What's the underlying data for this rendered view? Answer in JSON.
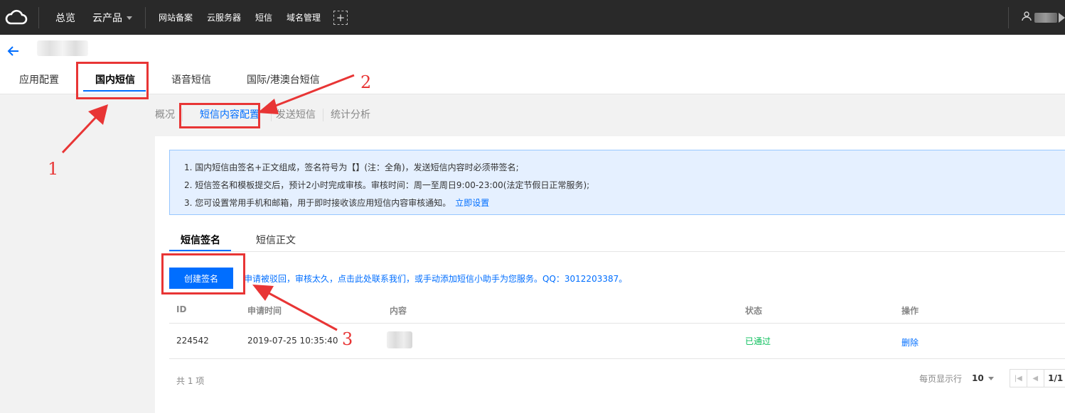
{
  "topnav": {
    "overview": "总览",
    "products": "云产品",
    "links": [
      "网站备案",
      "云服务器",
      "短信",
      "域名管理"
    ],
    "plus": "+"
  },
  "header": {
    "main_tabs": [
      "应用配置",
      "国内短信",
      "语音短信",
      "国际/港澳台短信"
    ]
  },
  "subtabs": [
    "概况",
    "短信内容配置",
    "发送短信",
    "统计分析"
  ],
  "notice": {
    "line1": "1. 国内短信由签名+正文组成，签名符号为【】(注：全角)，发送短信内容时必须带签名;",
    "line2": "2. 短信签名和模板提交后，预计2小时完成审核。审核时间：周一至周日9:00-23:00(法定节假日正常服务);",
    "line3": "3. 您可设置常用手机和邮箱，用于即时接收该应用短信内容审核通知。",
    "line3_link": "立即设置"
  },
  "inner_tabs": [
    "短信签名",
    "短信正文"
  ],
  "create_button": "创建签名",
  "help_text": "申请被驳回，审核太久，点击此处联系我们，或手动添加短信小助手为您服务。QQ：3012203387。",
  "table": {
    "headers": [
      "ID",
      "申请时间",
      "内容",
      "状态",
      "操作"
    ],
    "rows": [
      {
        "id": "224542",
        "time": "2019-07-25 10:35:40",
        "status": "已通过",
        "action": "删除"
      }
    ]
  },
  "footer": {
    "total": "共 1 项",
    "per_page_label": "每页显示行",
    "per_page": "10",
    "page": "1/1"
  },
  "annotations": [
    "1",
    "2",
    "3"
  ],
  "colors": {
    "accent": "#006eff",
    "annotation": "#e83535",
    "success": "#0abf5b"
  }
}
